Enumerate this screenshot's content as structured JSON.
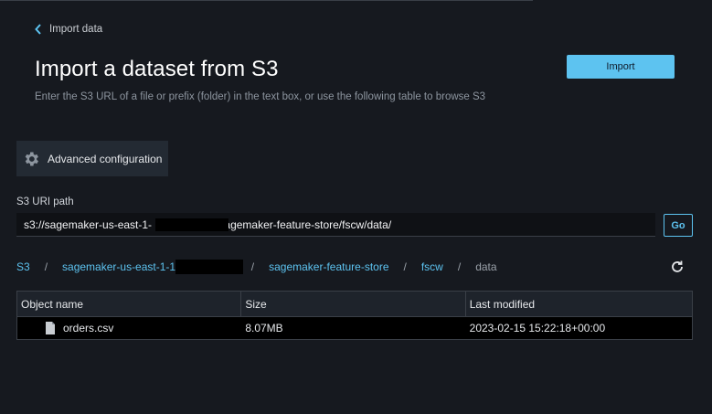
{
  "nav": {
    "back_label": "Import data"
  },
  "header": {
    "title": "Import a dataset from S3",
    "subtitle": "Enter the S3 URL of a file or prefix (folder) in the text box, or use the following table to browse S3",
    "import_label": "Import"
  },
  "advanced": {
    "label": "Advanced configuration",
    "icon": "gear-icon"
  },
  "uri": {
    "label": "S3 URI path",
    "value": "s3://sagemaker-us-east-1-                   7/sagemaker-feature-store/fscw/data/",
    "go_label": "Go"
  },
  "breadcrumbs": [
    {
      "label": "S3"
    },
    {
      "label": "sagemaker-us-east-1-1                  7"
    },
    {
      "label": "sagemaker-feature-store"
    },
    {
      "label": "fscw"
    },
    {
      "label": "data"
    }
  ],
  "breadcrumb_separator": "/",
  "table": {
    "columns": [
      "Object name",
      "Size",
      "Last modified"
    ],
    "rows": [
      {
        "name": "orders.csv",
        "size": "8.07MB",
        "modified": "2023-02-15 15:22:18+00:00"
      }
    ]
  },
  "colors": {
    "accent": "#5dc3f0",
    "background": "#16191f"
  }
}
